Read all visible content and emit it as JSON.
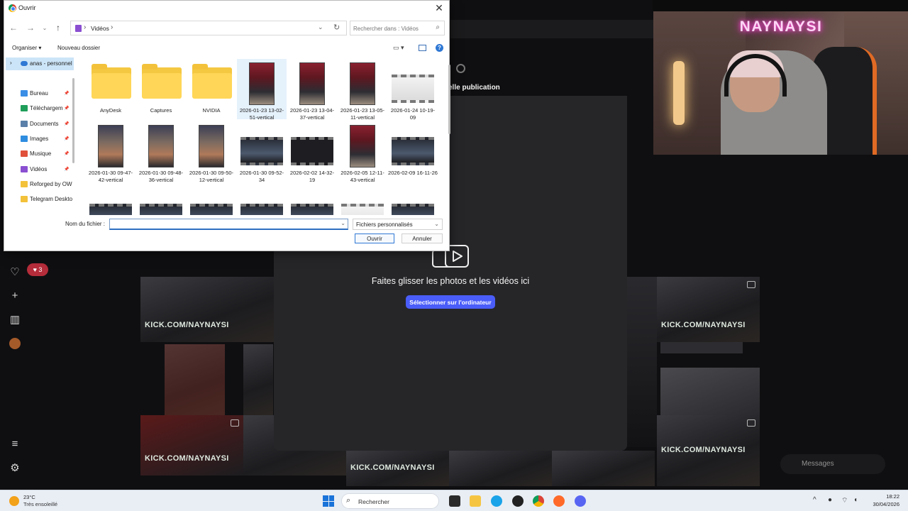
{
  "dialog": {
    "title": "Ouvrir",
    "address": {
      "location": "Vidéos"
    },
    "search_placeholder": "Rechercher dans : Vidéos",
    "toolbar": {
      "organize": "Organiser",
      "new_folder": "Nouveau dossier"
    },
    "nav_items": [
      {
        "label": "anas - personnel",
        "icon": "cloud-icon",
        "color": "#2f78d4"
      },
      {
        "label": "Bureau",
        "icon": "desktop-icon",
        "color": "#3a8ee6",
        "pinned": true
      },
      {
        "label": "Téléchargem",
        "icon": "download-icon",
        "color": "#1f9e5a",
        "pinned": true
      },
      {
        "label": "Documents",
        "icon": "documents-icon",
        "color": "#5a7fa8",
        "pinned": true
      },
      {
        "label": "Images",
        "icon": "images-icon",
        "color": "#2f8de0",
        "pinned": true
      },
      {
        "label": "Musique",
        "icon": "music-icon",
        "color": "#e0503a",
        "pinned": true
      },
      {
        "label": "Vidéos",
        "icon": "videos-icon",
        "color": "#8b4fd1",
        "pinned": true
      },
      {
        "label": "Reforged by OW",
        "icon": "folder-icon",
        "color": "#f3c23a"
      },
      {
        "label": "Telegram Deskto",
        "icon": "folder-icon",
        "color": "#f3c23a"
      }
    ],
    "files": [
      {
        "label": "AnyDesk",
        "type": "folder"
      },
      {
        "label": "Captures",
        "type": "folder"
      },
      {
        "label": "NVIDIA",
        "type": "folder"
      },
      {
        "label": "2026-01-23 13-02-51-vertical",
        "type": "video-vertical"
      },
      {
        "label": "2026-01-23 13-04-37-vertical",
        "type": "video-vertical"
      },
      {
        "label": "2026-01-23 13-05-11-vertical",
        "type": "video-vertical"
      },
      {
        "label": "2026-01-24 10-19-09",
        "type": "video-light"
      },
      {
        "label": "2026-01-30 09-47-42-vertical",
        "type": "video-vertical-b"
      },
      {
        "label": "2026-01-30 09-48-36-vertical",
        "type": "video-vertical-b"
      },
      {
        "label": "2026-01-30 09-50-12-vertical",
        "type": "video-vertical-b"
      },
      {
        "label": "2026-01-30 09-52-34",
        "type": "video-mid"
      },
      {
        "label": "2026-02-02 14-32-19",
        "type": "video-dark"
      },
      {
        "label": "2026-02-05 12-11-43-vertical",
        "type": "video-vertical"
      },
      {
        "label": "2026-02-09 16-11-26",
        "type": "video-mid"
      }
    ],
    "filename_label": "Nom du fichier :",
    "filename_value": "",
    "filetype": "Fichiers personnalisés",
    "open_button": "Ouvrir",
    "cancel_button": "Annuler"
  },
  "background_app": {
    "modal_title": "elle publication",
    "drag_text": "Faites glisser les photos et les vidéos ici",
    "select_button": "Sélectionner sur l'ordinateur",
    "like_count": "3",
    "messages_label": "Messages",
    "watermark": "KICK.COM/NAYNAYSI",
    "accent_color": "#4a5df9"
  },
  "webcam": {
    "neon_text": "NAYNAYSI"
  },
  "taskbar": {
    "weather_temp": "23°C",
    "weather_desc": "Très ensoleillé",
    "search_label": "Rechercher",
    "time": "18:22",
    "date": "30/04/2026"
  }
}
